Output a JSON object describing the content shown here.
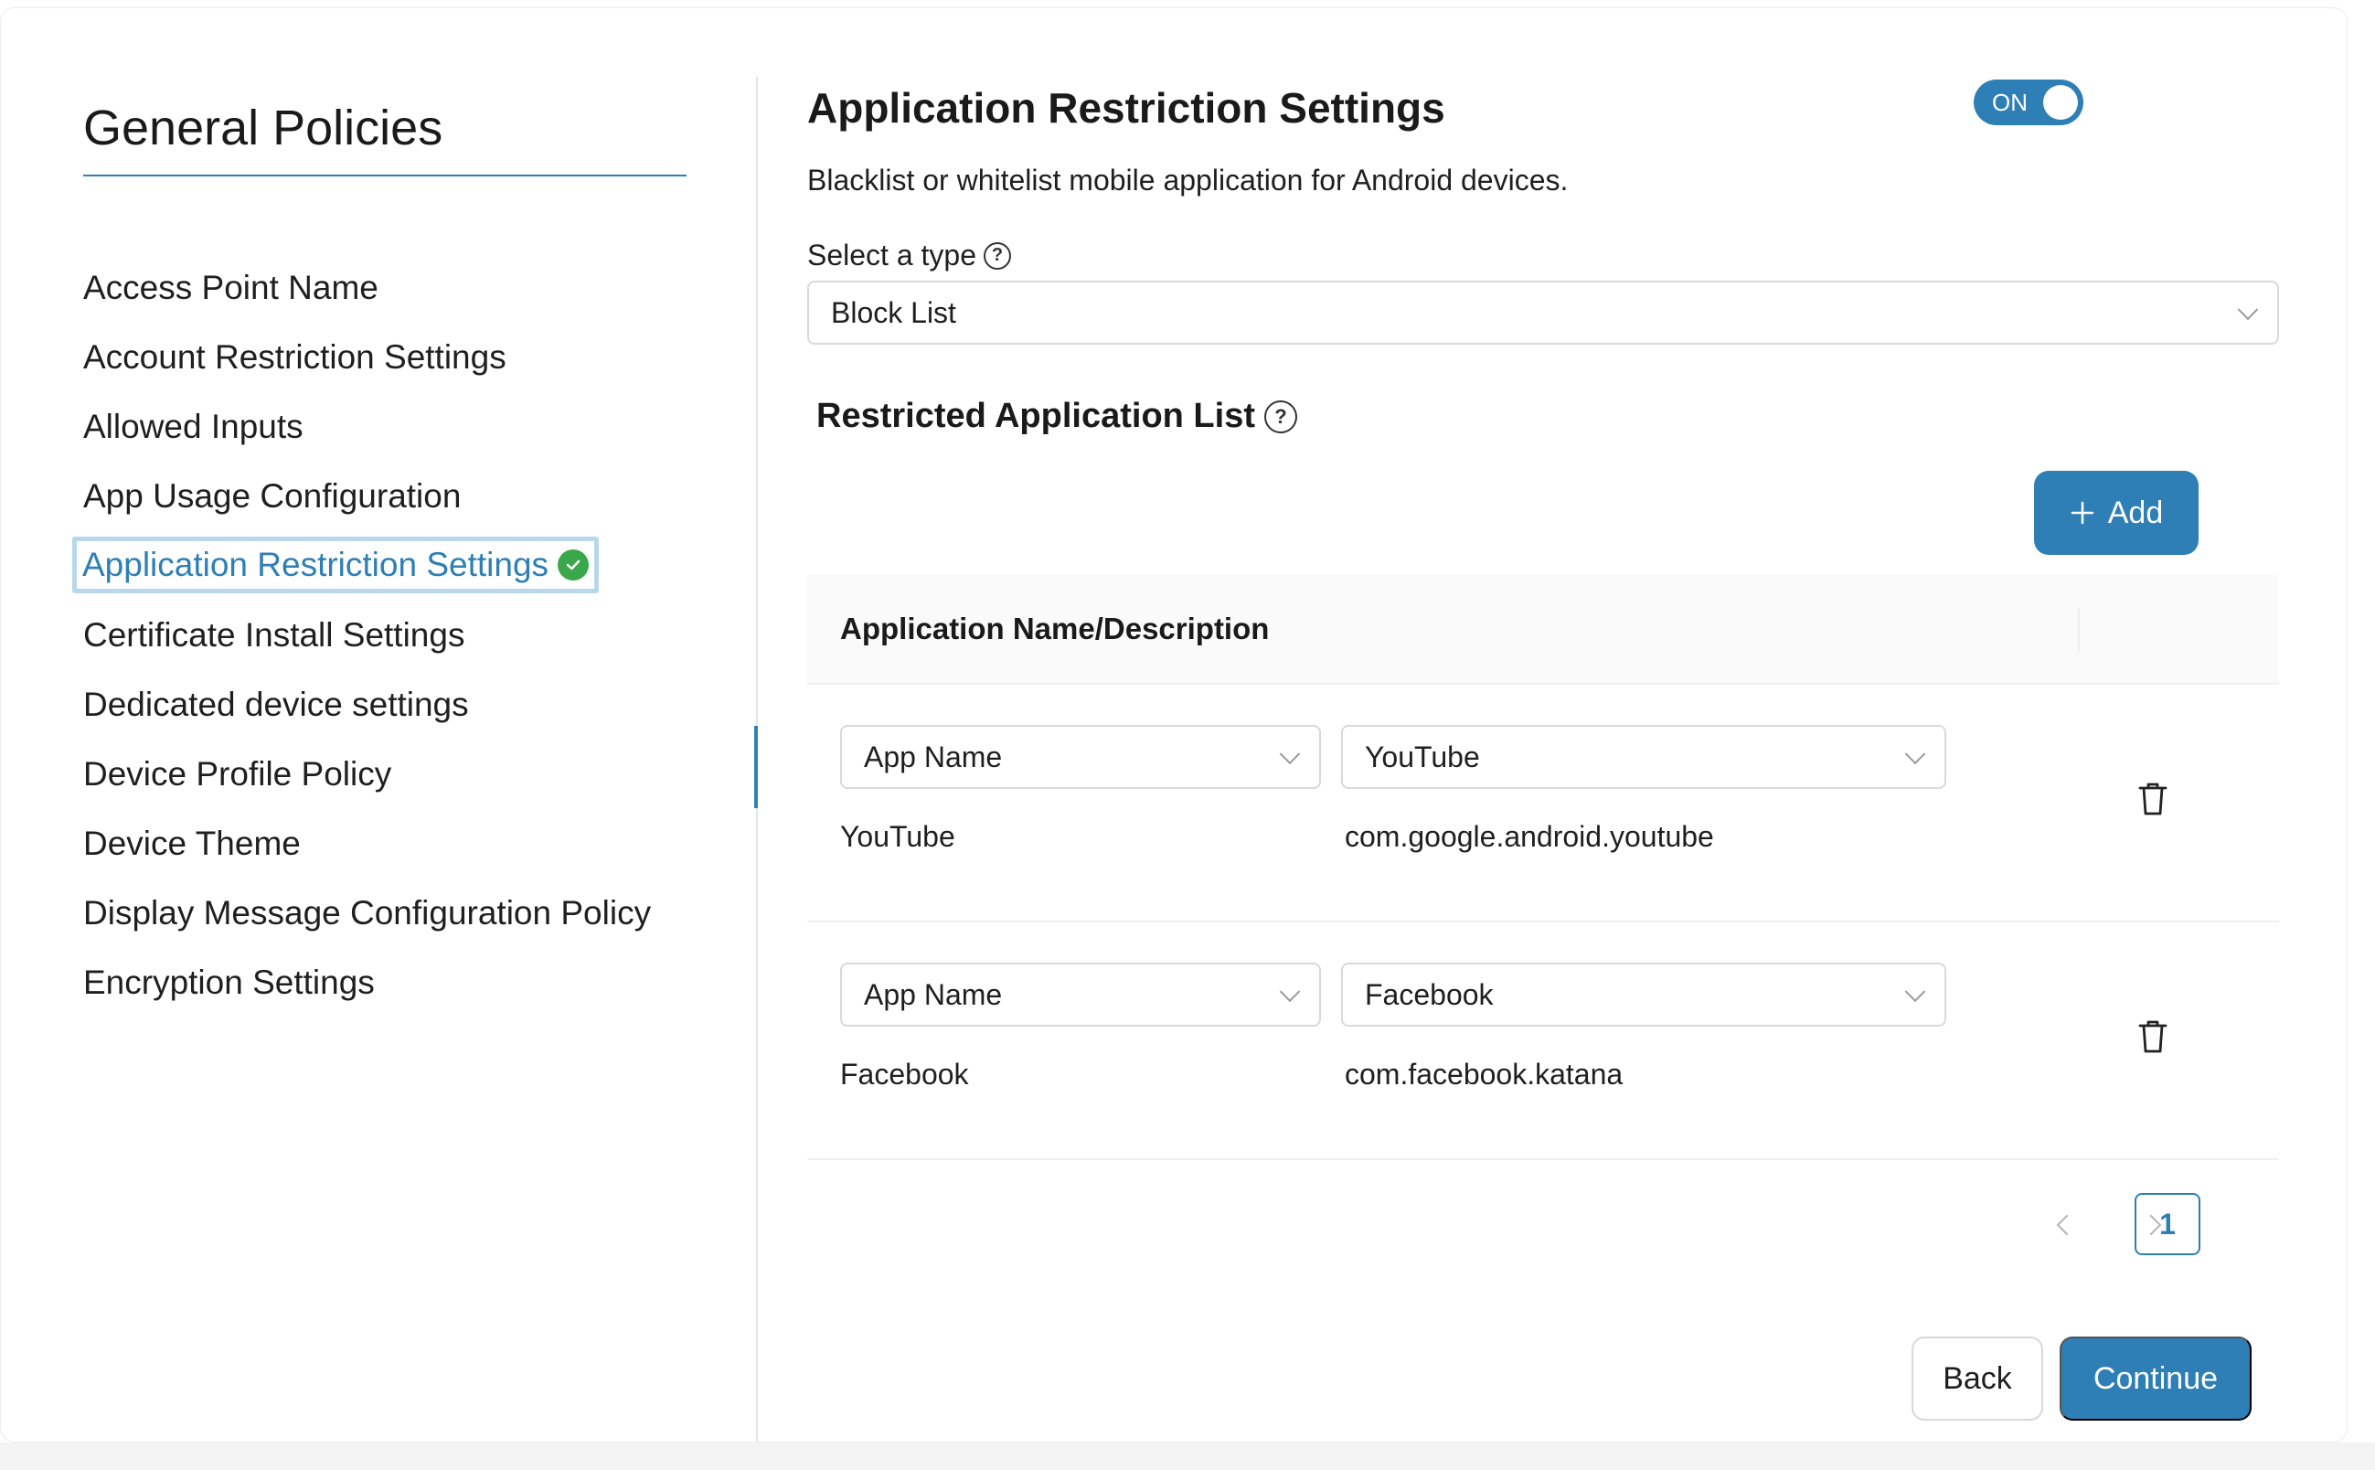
{
  "sidebar": {
    "title": "General Policies",
    "items": [
      {
        "label": "Access Point Name"
      },
      {
        "label": "Account Restriction Settings"
      },
      {
        "label": "Allowed Inputs"
      },
      {
        "label": "App Usage Configuration"
      },
      {
        "label": "Application Restriction Settings",
        "active": true
      },
      {
        "label": "Certificate Install Settings"
      },
      {
        "label": "Dedicated device settings"
      },
      {
        "label": "Device Profile Policy"
      },
      {
        "label": "Device Theme"
      },
      {
        "label": "Display Message Configuration Policy"
      },
      {
        "label": "Encryption Settings"
      }
    ]
  },
  "main": {
    "title": "Application Restriction Settings",
    "toggle": {
      "label": "ON",
      "state": "on"
    },
    "description": "Blacklist or whitelist mobile application for Android devices.",
    "type_label": "Select a type",
    "type_value": "Block List",
    "section_title": "Restricted Application List",
    "add_label": "Add",
    "table": {
      "header": "Application Name/Description",
      "rows": [
        {
          "criteria": "App Name",
          "app": "YouTube",
          "name": "YouTube",
          "package": "com.google.android.youtube"
        },
        {
          "criteria": "App Name",
          "app": "Facebook",
          "name": "Facebook",
          "package": "com.facebook.katana"
        }
      ]
    },
    "pagination": {
      "current": "1"
    },
    "back_label": "Back",
    "continue_label": "Continue"
  },
  "colors": {
    "accent": "#2e7fb5",
    "success": "#3aa84a"
  }
}
